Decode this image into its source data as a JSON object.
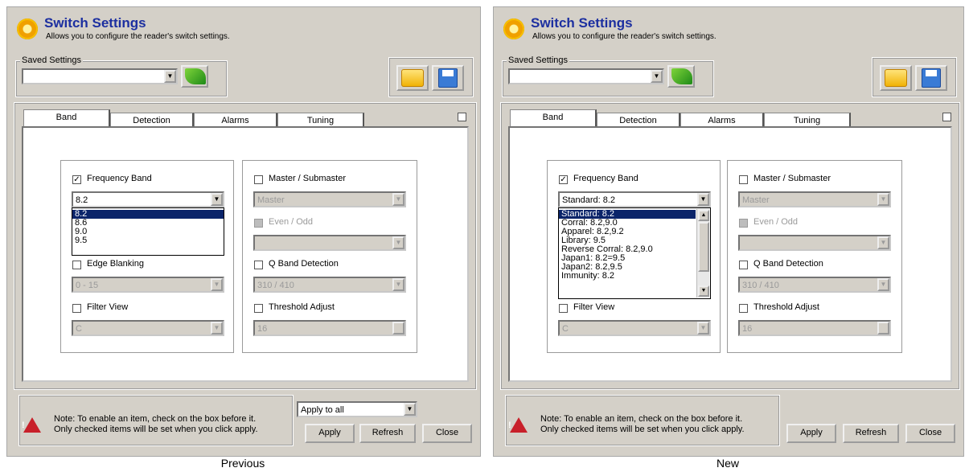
{
  "panels": [
    {
      "title": "Switch Settings",
      "subtitle": "Allows you to configure the reader's switch settings.",
      "saved_settings_label": "Saved Settings",
      "saved_settings_value": "",
      "tabs": [
        "Band",
        "Detection",
        "Alarms",
        "Tuning"
      ],
      "frequency_band": {
        "label": "Frequency Band",
        "checked": true,
        "value": "8.2",
        "options": [
          "8.2",
          "8.6",
          "9.0",
          "9.5"
        ],
        "selected_option": "8.2"
      },
      "edge_blanking": {
        "label": "Edge Blanking",
        "value": "0 - 15"
      },
      "filter_view": {
        "label": "Filter View",
        "value": "C"
      },
      "master_submaster": {
        "label": "Master / Submaster",
        "value": "Master"
      },
      "even_odd": {
        "label": "Even / Odd",
        "value": ""
      },
      "q_band": {
        "label": "Q Band Detection",
        "value": "310 / 410"
      },
      "threshold": {
        "label": "Threshold Adjust",
        "value": "16"
      },
      "note_line1": "Note: To enable an item, check on the box before it.",
      "note_line2": "Only checked items will be set when you click apply.",
      "apply_to": "Apply to all",
      "apply": "Apply",
      "refresh": "Refresh",
      "close": "Close",
      "caption": "Previous"
    },
    {
      "title": "Switch Settings",
      "subtitle": "Allows you to configure the reader's switch settings.",
      "saved_settings_label": "Saved Settings",
      "saved_settings_value": "",
      "tabs": [
        "Band",
        "Detection",
        "Alarms",
        "Tuning"
      ],
      "frequency_band": {
        "label": "Frequency Band",
        "checked": true,
        "value": "Standard: 8.2",
        "options": [
          "Standard: 8.2",
          "Corral: 8.2,9.0",
          "Apparel: 8.2,9.2",
          "Library: 9.5",
          "Reverse Corral: 8.2,9.0",
          "Japan1: 8.2=9.5",
          "Japan2: 8.2,9.5",
          "Immunity: 8.2"
        ],
        "selected_option": "Standard: 8.2"
      },
      "filter_view": {
        "label": "Filter View",
        "value": "C"
      },
      "master_submaster": {
        "label": "Master / Submaster",
        "value": "Master"
      },
      "even_odd": {
        "label": "Even / Odd",
        "value": ""
      },
      "q_band": {
        "label": "Q Band Detection",
        "value": "310 / 410"
      },
      "threshold": {
        "label": "Threshold Adjust",
        "value": "16"
      },
      "note_line1": "Note: To enable an item, check on the box before it.",
      "note_line2": "Only checked items will be set when you click apply.",
      "apply": "Apply",
      "refresh": "Refresh",
      "close": "Close",
      "caption": "New"
    }
  ],
  "icons": {
    "settings": "gear-icon",
    "load": "leaf-load-icon",
    "open": "folder-icon",
    "save": "floppy-icon",
    "warning": "warning-triangle-icon",
    "dropdown": "chevron-down-icon"
  },
  "colors": {
    "title": "#1c2fa0",
    "selection": "#0a246a",
    "window": "#d4d0c8",
    "warning": "#c8202a"
  }
}
